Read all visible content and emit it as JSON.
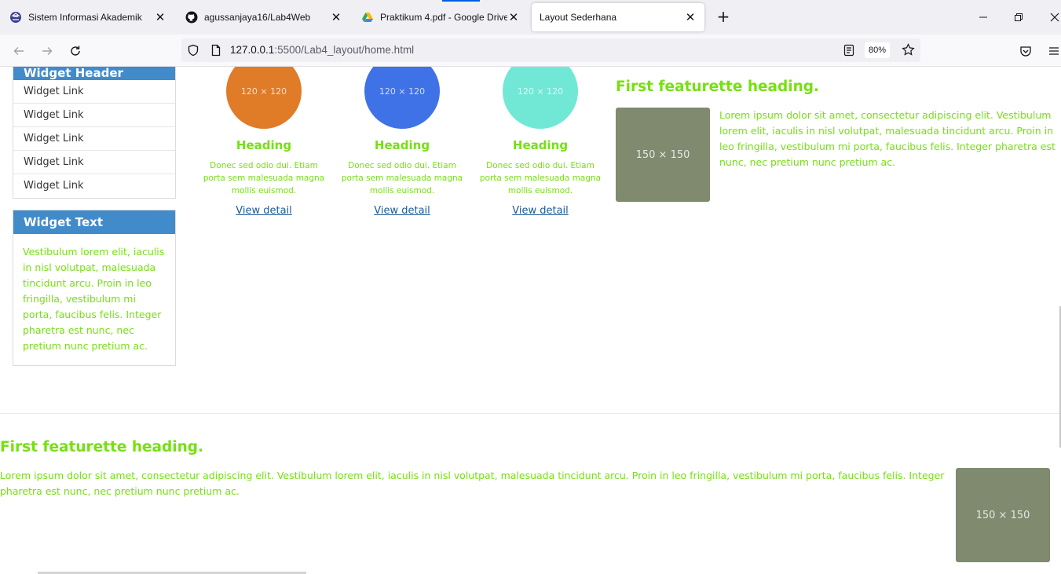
{
  "browser": {
    "tabs": [
      {
        "title": "Sistem Informasi Akademik",
        "icon": "university-icon",
        "active": false
      },
      {
        "title": "agussanjaya16/Lab4Web",
        "icon": "github-icon",
        "active": false
      },
      {
        "title": "Praktikum 4.pdf - Google Drive",
        "icon": "google-drive-icon",
        "active": false
      },
      {
        "title": "Layout Sederhana",
        "icon": "none",
        "active": true
      }
    ],
    "url_host": "127.0.0.1",
    "url_rest": ":5500/Lab4_layout/home.html",
    "zoom": "80%"
  },
  "page": {
    "colors": {
      "accent_green": "#76e012",
      "widget_blue": "#428bca",
      "thumb_gray": "#7f8a6e",
      "link": "#1a5a99"
    },
    "widget_header": {
      "title": "Widget Header",
      "links": [
        "Widget Link",
        "Widget Link",
        "Widget Link",
        "Widget Link",
        "Widget Link"
      ]
    },
    "widget_text": {
      "title": "Widget Text",
      "body": "Vestibulum lorem elit, iaculis in nisl volutpat, malesuada tincidunt arcu. Proin in leo fringilla, vestibulum mi porta, faucibus felis. Integer pharetra est nunc, nec pretium nunc pretium ac."
    },
    "columns": [
      {
        "placeholder": "120 × 120",
        "color": "#e07b28",
        "heading": "Heading",
        "text": "Donec sed odio dui. Etiam porta sem malesuada magna mollis euismod.",
        "link": "View detail"
      },
      {
        "placeholder": "120 × 120",
        "color": "#3f72e6",
        "heading": "Heading",
        "text": "Donec sed odio dui. Etiam porta sem malesuada magna mollis euismod.",
        "link": "View detail"
      },
      {
        "placeholder": "120 × 120",
        "color": "#71e8d6",
        "heading": "Heading",
        "text": "Donec sed odio dui. Etiam porta sem malesuada magna mollis euismod.",
        "link": "View detail"
      }
    ],
    "featurette_1": {
      "heading": "First featurette heading.",
      "image": "150 × 150",
      "text": "Lorem ipsum dolor sit amet, consectetur adipiscing elit. Vestibulum lorem elit, iaculis in nisl volutpat, malesuada tincidunt arcu. Proin in leo fringilla, vestibulum mi porta, faucibus felis. Integer pharetra est nunc, nec pretium nunc pretium ac."
    },
    "featurette_2": {
      "heading": "First featurette heading.",
      "image": "150 × 150",
      "text": "Lorem ipsum dolor sit amet, consectetur adipiscing elit. Vestibulum lorem elit, iaculis in nisl volutpat, malesuada tincidunt arcu. Proin in leo fringilla, vestibulum mi porta, faucibus felis. Integer pharetra est nunc, nec pretium nunc pretium ac."
    }
  }
}
